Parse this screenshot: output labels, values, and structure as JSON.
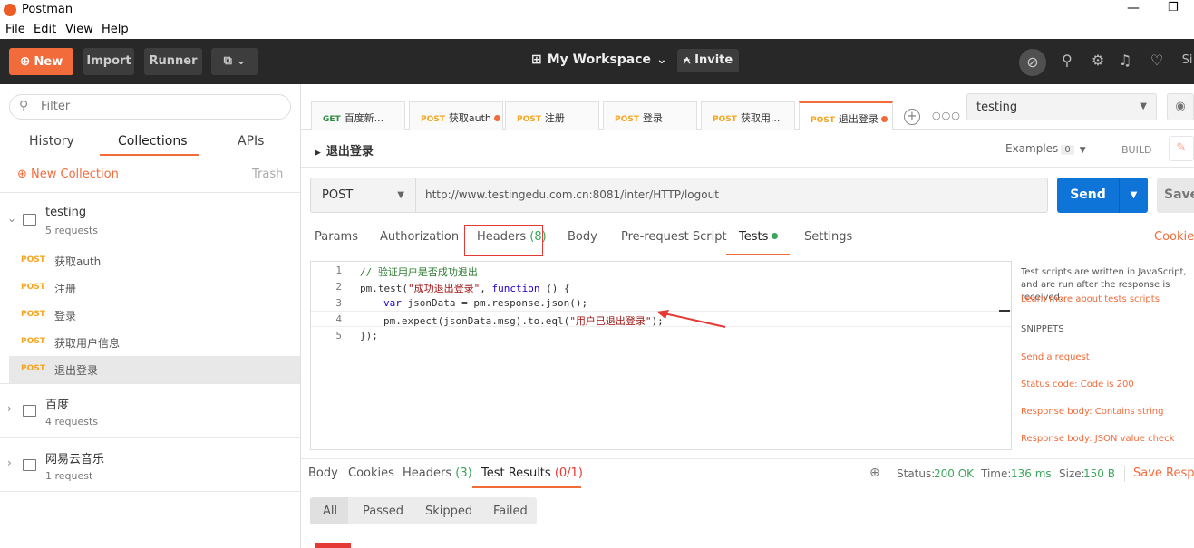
{
  "window": {
    "title": "Postman",
    "minimize": "—",
    "maximize": "❐"
  },
  "menu": [
    "File",
    "Edit",
    "View",
    "Help"
  ],
  "header": {
    "new_label": "New",
    "import_label": "Import",
    "runner_label": "Runner",
    "workspace_label": "My Workspace",
    "invite_label": "Invite",
    "truncated_user": "Si"
  },
  "sidebar": {
    "filter_placeholder": "Filter",
    "tabs": [
      "History",
      "Collections",
      "APIs"
    ],
    "new_collection": "New Collection",
    "trash": "Trash",
    "collections": [
      {
        "name": "testing",
        "count": "5 requests",
        "requests": [
          {
            "method": "POST",
            "name": "获取auth"
          },
          {
            "method": "POST",
            "name": "注册"
          },
          {
            "method": "POST",
            "name": "登录"
          },
          {
            "method": "POST",
            "name": "获取用户信息"
          },
          {
            "method": "POST",
            "name": "退出登录"
          }
        ]
      },
      {
        "name": "百度",
        "count": "4 requests"
      },
      {
        "name": "网易云音乐",
        "count": "1 request"
      }
    ]
  },
  "request_tabs": [
    {
      "method": "GET",
      "name": "百度新...",
      "dot": false
    },
    {
      "method": "POST",
      "name": "获取auth",
      "dot": true
    },
    {
      "method": "POST",
      "name": "注册",
      "dot": false
    },
    {
      "method": "POST",
      "name": "登录",
      "dot": false
    },
    {
      "method": "POST",
      "name": "获取用...",
      "dot": false
    },
    {
      "method": "POST",
      "name": "退出登录",
      "dot": true
    }
  ],
  "environment": "testing",
  "request": {
    "title": "退出登录",
    "examples_label": "Examples",
    "examples_count": "0",
    "build_label": "BUILD",
    "method": "POST",
    "url": "http://www.testingedu.com.cn:8081/inter/HTTP/logout",
    "send_label": "Send",
    "save_label": "Save"
  },
  "request_subtabs": {
    "params": "Params",
    "authorization": "Authorization",
    "headers": "Headers",
    "headers_count": "(8)",
    "body": "Body",
    "prerequest": "Pre-request Script",
    "tests": "Tests",
    "settings": "Settings",
    "cookies": "Cookies"
  },
  "editor": {
    "line_numbers": [
      "1",
      "2",
      "3",
      "4",
      "5"
    ],
    "line1": "// 验证用户是否成功退出",
    "line2_a": "pm.test(",
    "line2_str": "\"成功退出登录\"",
    "line2_b": ", ",
    "line2_kw": "function",
    "line2_c": " () {",
    "line3_kw": "var",
    "line3_b": " jsonData = pm.response.json();",
    "line4_a": "pm.expect(jsonData.msg).to.eql(",
    "line4_str": "\"用户已退出登录\"",
    "line4_b": ");",
    "line5": "});"
  },
  "snippets": {
    "description": "Test scripts are written in JavaScript, and are run after the response is received.",
    "learn_more": "Learn more about tests scripts",
    "title": "SNIPPETS",
    "items": [
      "Send a request",
      "Status code: Code is 200",
      "Response body: Contains string",
      "Response body: JSON value check"
    ]
  },
  "response": {
    "tabs": {
      "body": "Body",
      "cookies": "Cookies",
      "headers": "Headers",
      "headers_count": "(3)",
      "test_results": "Test Results",
      "test_results_count": "(0/1)"
    },
    "status_label": "Status:",
    "status_value": "200 OK",
    "time_label": "Time:",
    "time_value": "136 ms",
    "size_label": "Size:",
    "size_value": "150 B",
    "save_response": "Save Response",
    "filters": [
      "All",
      "Passed",
      "Skipped",
      "Failed"
    ]
  },
  "colors": {
    "accent": "#f26b3a",
    "send_blue": "#0f74d8",
    "header_bg": "#282828",
    "post_method": "#f5a623",
    "status_green": "#3ba55c",
    "annotation_red": "#e53935"
  }
}
